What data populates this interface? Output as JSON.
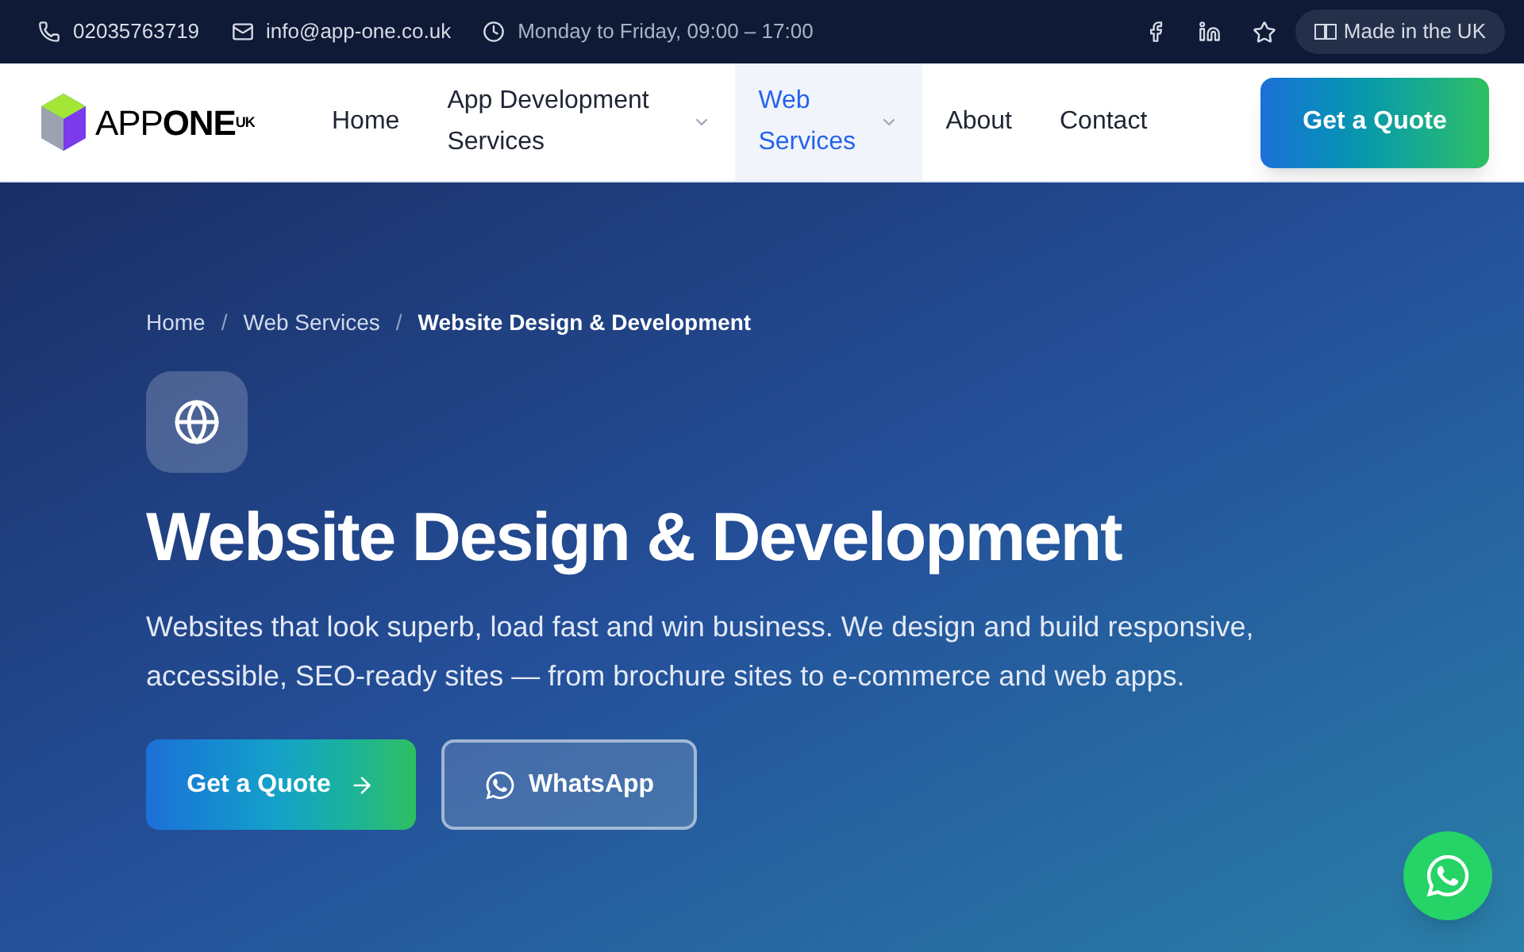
{
  "top_bar": {
    "phone": "02035763719",
    "email": "info@app-one.co.uk",
    "hours": "Monday to Friday, 09:00 – 17:00",
    "badge": "Made in the UK"
  },
  "logo": {
    "text": "APP",
    "bold": "ONE",
    "sup": "UK"
  },
  "nav": [
    {
      "label": "Home",
      "dropdown": false,
      "selected": false
    },
    {
      "label": "App Development Services",
      "dropdown": true,
      "selected": false
    },
    {
      "label": "Web Services",
      "dropdown": true,
      "selected": true
    },
    {
      "label": "About",
      "dropdown": false,
      "selected": false
    },
    {
      "label": "Contact",
      "dropdown": false,
      "selected": false
    }
  ],
  "nav_button": "Get a Quote",
  "breadcrumb": [
    {
      "label": "Home",
      "current": false
    },
    {
      "label": "Web Services",
      "current": false
    },
    {
      "label": "Website Design & Development",
      "current": true
    }
  ],
  "separator": "/",
  "hero": {
    "title": "Website Design & Development",
    "text": "Websites that look superb, load fast and win business. We design and build responsive, accessible, SEO-ready sites — from brochure sites to e-commerce and web apps.",
    "buttons": [
      {
        "label": "Get a Quote",
        "kind": "primary"
      },
      {
        "label": "WhatsApp",
        "kind": "outline"
      }
    ]
  }
}
